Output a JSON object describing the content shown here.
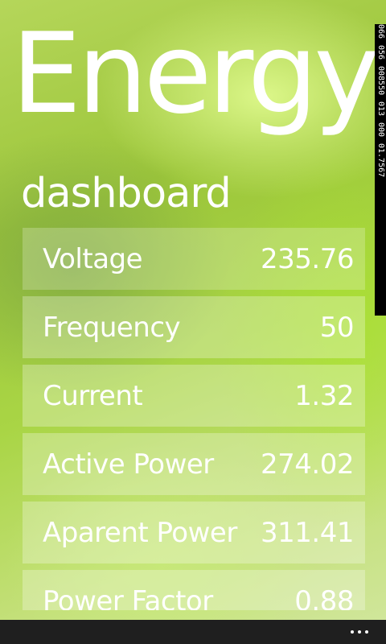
{
  "app": {
    "title": "Energy",
    "subtitle": "dashboard"
  },
  "readouts": [
    "066",
    "056",
    "008550",
    "013",
    "000",
    "01.7567"
  ],
  "metrics": [
    {
      "label": "Voltage",
      "value": "235.76"
    },
    {
      "label": "Frequency",
      "value": "50"
    },
    {
      "label": "Current",
      "value": "1.32"
    },
    {
      "label": "Active Power",
      "value": "274.02"
    },
    {
      "label": "Aparent Power",
      "value": "311.41"
    },
    {
      "label": "Power Factor",
      "value": "0.88"
    }
  ],
  "app_bar": {
    "more_icon": "ellipsis-icon"
  }
}
